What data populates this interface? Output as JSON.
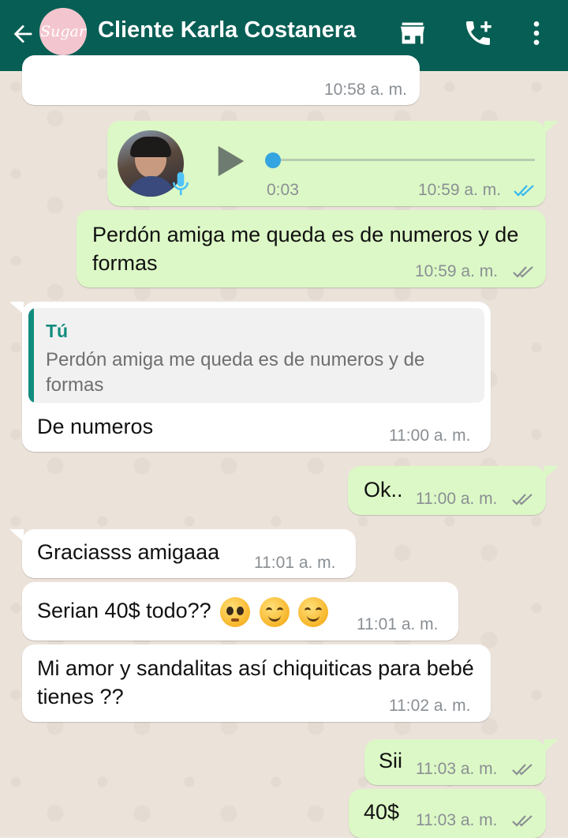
{
  "header": {
    "contact_name": "Cliente Karla Costanera",
    "avatar_text": "Sugar",
    "icons": [
      "back-arrow-icon",
      "store-icon",
      "add-call-icon",
      "more-vert-icon"
    ]
  },
  "colors": {
    "header": "#075e54",
    "outgoing": "#dcf8c6",
    "incoming": "#ffffff",
    "read_tick": "#34b7f1",
    "quote_accent": "#128c7e"
  },
  "messages": [
    {
      "dir": "in",
      "text": "",
      "time": "10:58 a. m."
    },
    {
      "dir": "out",
      "type": "voice",
      "duration": "0:03",
      "progress": 0.0,
      "time": "10:59 a. m.",
      "status": "read"
    },
    {
      "dir": "out",
      "text": "Perdón amiga me queda es de numeros y de formas",
      "time": "10:59 a. m.",
      "status": "delivered"
    },
    {
      "dir": "in",
      "quote": {
        "author": "Tú",
        "text": "Perdón amiga me queda es de numeros y de formas"
      },
      "text": "De numeros",
      "time": "11:00 a. m."
    },
    {
      "dir": "out",
      "text": "Ok..",
      "time": "11:00 a. m.",
      "status": "delivered"
    },
    {
      "dir": "in",
      "text": "Graciasss amigaaa",
      "time": "11:01 a. m."
    },
    {
      "dir": "in",
      "text": "Serian 40$ todo??",
      "emojis": [
        "pleading-face-emoji",
        "smiling-face-emoji",
        "smiling-face-emoji"
      ],
      "time": "11:01 a. m."
    },
    {
      "dir": "in",
      "text": "Mi amor y sandalitas así chiquiticas para bebé tienes ??",
      "time": "11:02 a. m."
    },
    {
      "dir": "out",
      "text": "Sii",
      "time": "11:03 a. m.",
      "status": "delivered"
    },
    {
      "dir": "out",
      "text": "40$",
      "time": "11:03 a. m.",
      "status": "delivered"
    }
  ]
}
